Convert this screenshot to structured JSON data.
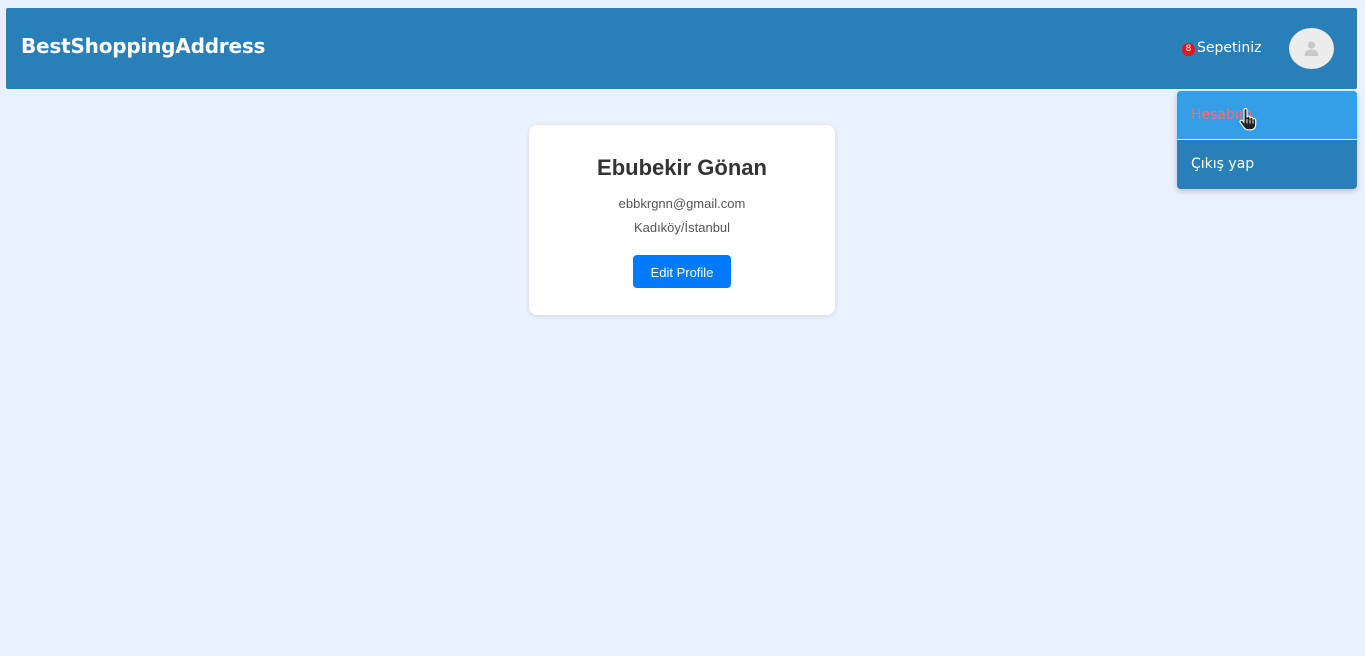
{
  "navbar": {
    "brand": "BestShoppingAddress",
    "cart": {
      "count": "8",
      "label": "Sepetiniz"
    },
    "avatar_icon": "user-avatar-icon"
  },
  "dropdown": {
    "items": [
      {
        "label": "Hesabım",
        "state": "hovered"
      },
      {
        "label": "Çıkış yap"
      }
    ]
  },
  "profile": {
    "name": "Ebubekir Gönan",
    "email": "ebbkrgnn@gmail.com",
    "location": "Kadıköy/İstanbul",
    "edit_button": "Edit Profile"
  },
  "colors": {
    "background": "#eaf1fe",
    "navbar": "#2980b9",
    "dropdown_hover": "#349ee6",
    "dropdown_active_text": "#ff6b6b",
    "badge": "#e3161a",
    "button": "#007bff"
  }
}
